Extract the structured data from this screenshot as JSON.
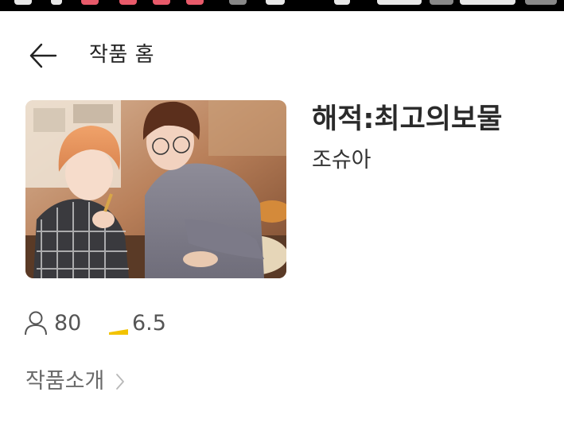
{
  "header": {
    "title": "작품 홈"
  },
  "work": {
    "title": "해적:최고의보물",
    "author": "조슈아"
  },
  "stats": {
    "views": "80",
    "rating": "6.5"
  },
  "intro": {
    "label": "작품소개"
  },
  "icons": {
    "back": "arrow-left-icon",
    "views": "person-icon",
    "rating": "rating-wedge-icon",
    "intro_chevron": "chevron-right-icon"
  },
  "colors": {
    "rating_accent": "#f2c300",
    "statusbar": "#000000"
  }
}
